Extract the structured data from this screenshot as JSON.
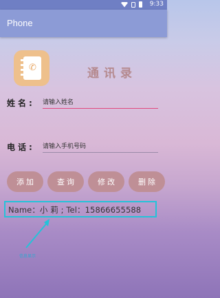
{
  "status": {
    "time": "9:33",
    "icons": [
      "wifi-icon",
      "sim-icon",
      "battery-icon"
    ]
  },
  "app_bar": {
    "title": "Phone"
  },
  "app_icon": "contacts-book-icon",
  "heading": "通讯录",
  "form": {
    "name_label": "姓名:",
    "name_placeholder": "请输入姓名",
    "phone_label": "电话:",
    "phone_placeholder": "请输入手机号码"
  },
  "buttons": {
    "add": "添加",
    "query": "查询",
    "edit": "修改",
    "delete": "删除"
  },
  "result": "Name：小 莉 ; Tel：15866655588",
  "annotation": "信息显示",
  "colors": {
    "app_bar": "#8c9bd6",
    "button": "#bf8f96",
    "heading": "#b58a8f",
    "name_underline": "#e0487f",
    "highlight": "#23c3d9"
  }
}
